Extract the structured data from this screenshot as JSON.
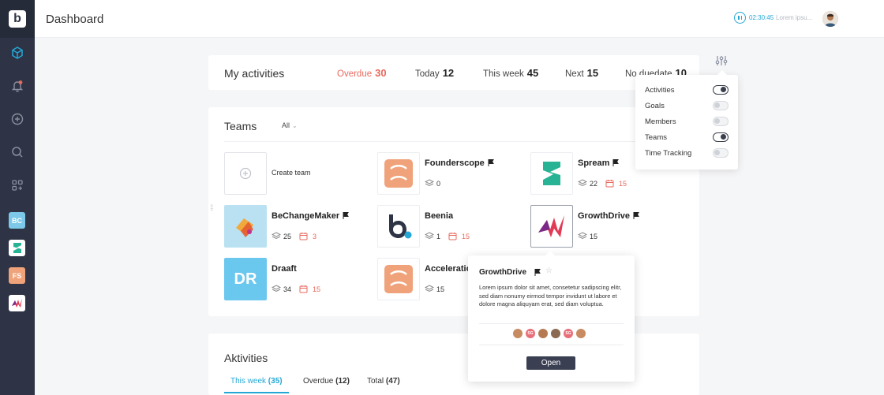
{
  "app": {
    "title": "Dashboard",
    "logo_letter": "b"
  },
  "timer": {
    "time": "02:30:45",
    "label": "Lorem ipsu..."
  },
  "sidebar": {
    "icons": [
      "cube-icon",
      "bell-icon",
      "plus-circle-icon",
      "search-icon",
      "grid-add-icon"
    ],
    "teams": [
      {
        "label": "BC",
        "color": "#7dc8e8"
      },
      {
        "label": "",
        "color": "#ffffff"
      },
      {
        "label": "FS",
        "color": "#f0a37a"
      },
      {
        "label": "",
        "color": "#ffffff"
      }
    ]
  },
  "activities": {
    "title": "My activities",
    "stats": [
      {
        "label": "Overdue",
        "count": "30"
      },
      {
        "label": "Today",
        "count": "12"
      },
      {
        "label": "This week",
        "count": "45"
      },
      {
        "label": "Next",
        "count": "15"
      },
      {
        "label": "No duedate",
        "count": "10"
      }
    ]
  },
  "teams": {
    "title": "Teams",
    "filter": "All",
    "create_label": "Create team",
    "items": [
      {
        "name": "Founderscope",
        "members": "0",
        "due": ""
      },
      {
        "name": "Spream",
        "members": "22",
        "due": "15"
      },
      {
        "name": "BeChangeMaker",
        "members": "25",
        "due": "3"
      },
      {
        "name": "Beenia",
        "members": "1",
        "due": "15"
      },
      {
        "name": "GrowthDrive",
        "members": "15",
        "due": ""
      },
      {
        "name": "Draaft",
        "members": "34",
        "due": "15",
        "initials": "DR"
      },
      {
        "name": "Acceleration",
        "members": "15",
        "due": ""
      }
    ]
  },
  "aktivities": {
    "title": "Aktivities",
    "tabs": [
      {
        "label": "This week",
        "count": "(35)"
      },
      {
        "label": "Overdue",
        "count": "(12)"
      },
      {
        "label": "Total",
        "count": "(47)"
      }
    ]
  },
  "settings_popover": {
    "items": [
      {
        "label": "Activities",
        "on": true
      },
      {
        "label": "Goals",
        "on": false
      },
      {
        "label": "Members",
        "on": false
      },
      {
        "label": "Teams",
        "on": true
      },
      {
        "label": "Time Tracking",
        "on": false
      }
    ]
  },
  "tooltip": {
    "name": "GrowthDrive",
    "description": "Lorem ipsum dolor sit amet, consetetur sadipscing elitr, sed diam nonumy eirmod tempor invidunt ut labore et dolore magna aliquyam erat, sed diam voluptua.",
    "avatars": [
      "",
      "SG",
      "",
      "",
      "SG",
      ""
    ],
    "open_label": "Open"
  },
  "colors": {
    "accent": "#25a7d6",
    "overdue": "#e8695d",
    "sidebar": "#2e3445"
  }
}
